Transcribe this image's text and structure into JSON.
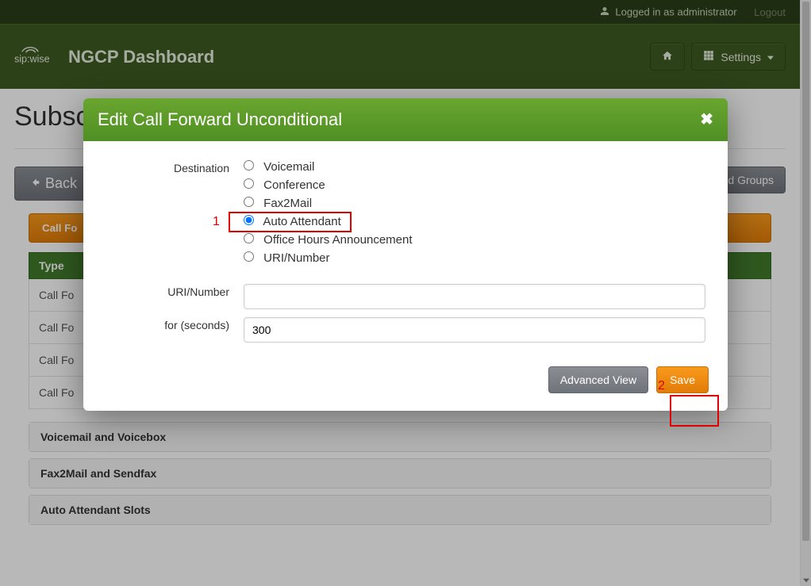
{
  "topbar": {
    "logged_in_text": "Logged in as administrator",
    "logout": "Logout"
  },
  "navbar": {
    "brand": "NGCP Dashboard",
    "settings": "Settings"
  },
  "page": {
    "title_visible": "Subsc",
    "back": "Back",
    "groups_button_visible": "d Groups",
    "call_forwards_header_visible": "Call Fo",
    "table_header_type": "Type",
    "rows": [
      {
        "label": "Call Fo"
      },
      {
        "label": "Call Fo"
      },
      {
        "label": "Call Fo"
      },
      {
        "label": "Call Fo"
      }
    ],
    "panels": {
      "voicemail": "Voicemail and Voicebox",
      "fax": "Fax2Mail and Sendfax",
      "aa": "Auto Attendant Slots"
    }
  },
  "modal": {
    "title": "Edit Call Forward Unconditional",
    "labels": {
      "destination": "Destination",
      "uri": "URI/Number",
      "for_seconds": "for (seconds)"
    },
    "destinations": {
      "voicemail": "Voicemail",
      "conference": "Conference",
      "fax2mail": "Fax2Mail",
      "auto_attendant": "Auto Attendant",
      "office_hours": "Office Hours Announcement",
      "uri_number": "URI/Number"
    },
    "uri_value": "",
    "for_seconds_value": "300",
    "buttons": {
      "advanced": "Advanced View",
      "save": "Save"
    }
  },
  "annotations": {
    "n1": "1",
    "n2": "2"
  }
}
